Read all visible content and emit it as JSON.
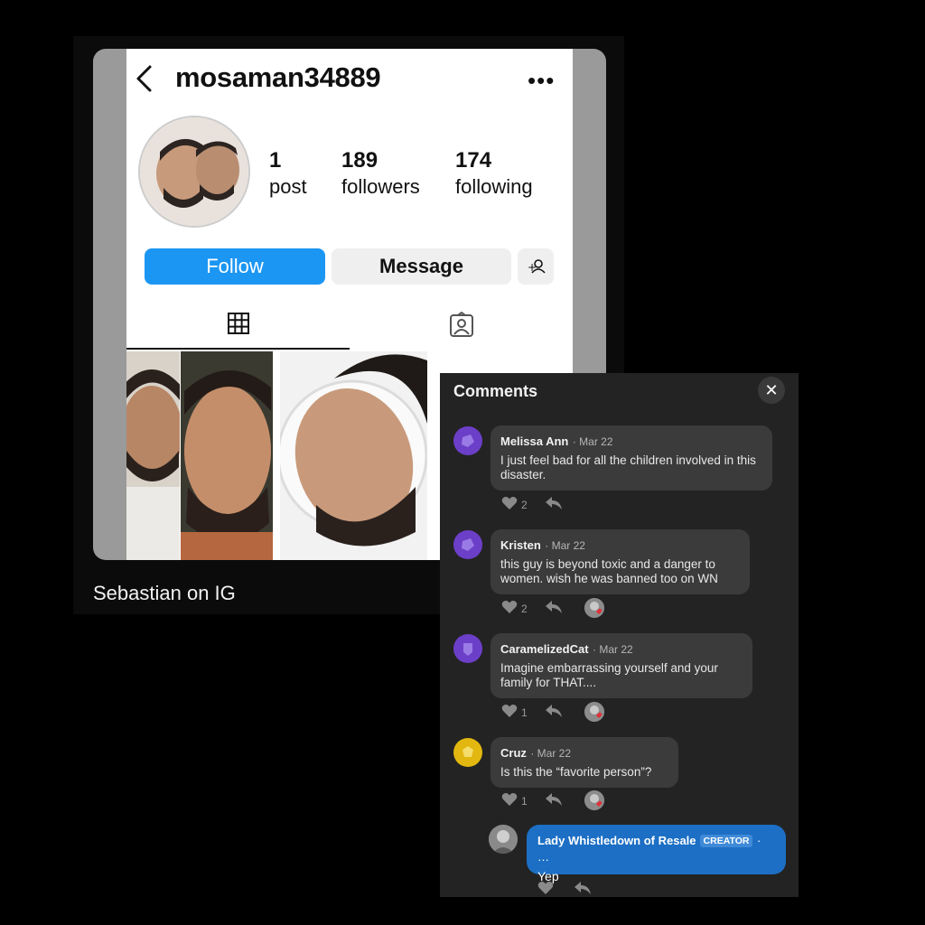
{
  "instagram": {
    "username": "mosaman34889",
    "more_icon": "more-horizontal-icon",
    "stats": [
      {
        "value": "1",
        "label": "post"
      },
      {
        "value": "189",
        "label": "followers"
      },
      {
        "value": "174",
        "label": "following"
      }
    ],
    "follow_label": "Follow",
    "message_label": "Message",
    "colors": {
      "follow": "#1c96f3"
    }
  },
  "caption": "Sebastian on IG",
  "comments_panel": {
    "title": "Comments",
    "close_glyph": "✕",
    "comments": [
      {
        "name": "Melissa Ann",
        "date": "· Mar 22",
        "text": "I just feel bad for all the children involved in this disaster.",
        "likes": "2",
        "avatar_color": "#6c3fc8"
      },
      {
        "name": "Kristen",
        "date": "· Mar 22",
        "text": "this guy is beyond toxic and a danger to women. wish he was banned too on WN",
        "likes": "2",
        "avatar_color": "#6c3fc8"
      },
      {
        "name": "CaramelizedCat",
        "date": "· Mar 22",
        "text": "Imagine embarrassing yourself and your family for THAT....",
        "likes": "1",
        "avatar_color": "#6c3fc8"
      },
      {
        "name": "Cruz",
        "date": "· Mar 22",
        "text": "Is this the “favorite person”?",
        "likes": "1",
        "avatar_color": "#e2b70f"
      }
    ],
    "creator_reply": {
      "name": "Lady Whistledown of Resale",
      "badge": "CREATOR",
      "more": "· …",
      "text": "Yep",
      "color": "#1c6fc4"
    }
  }
}
